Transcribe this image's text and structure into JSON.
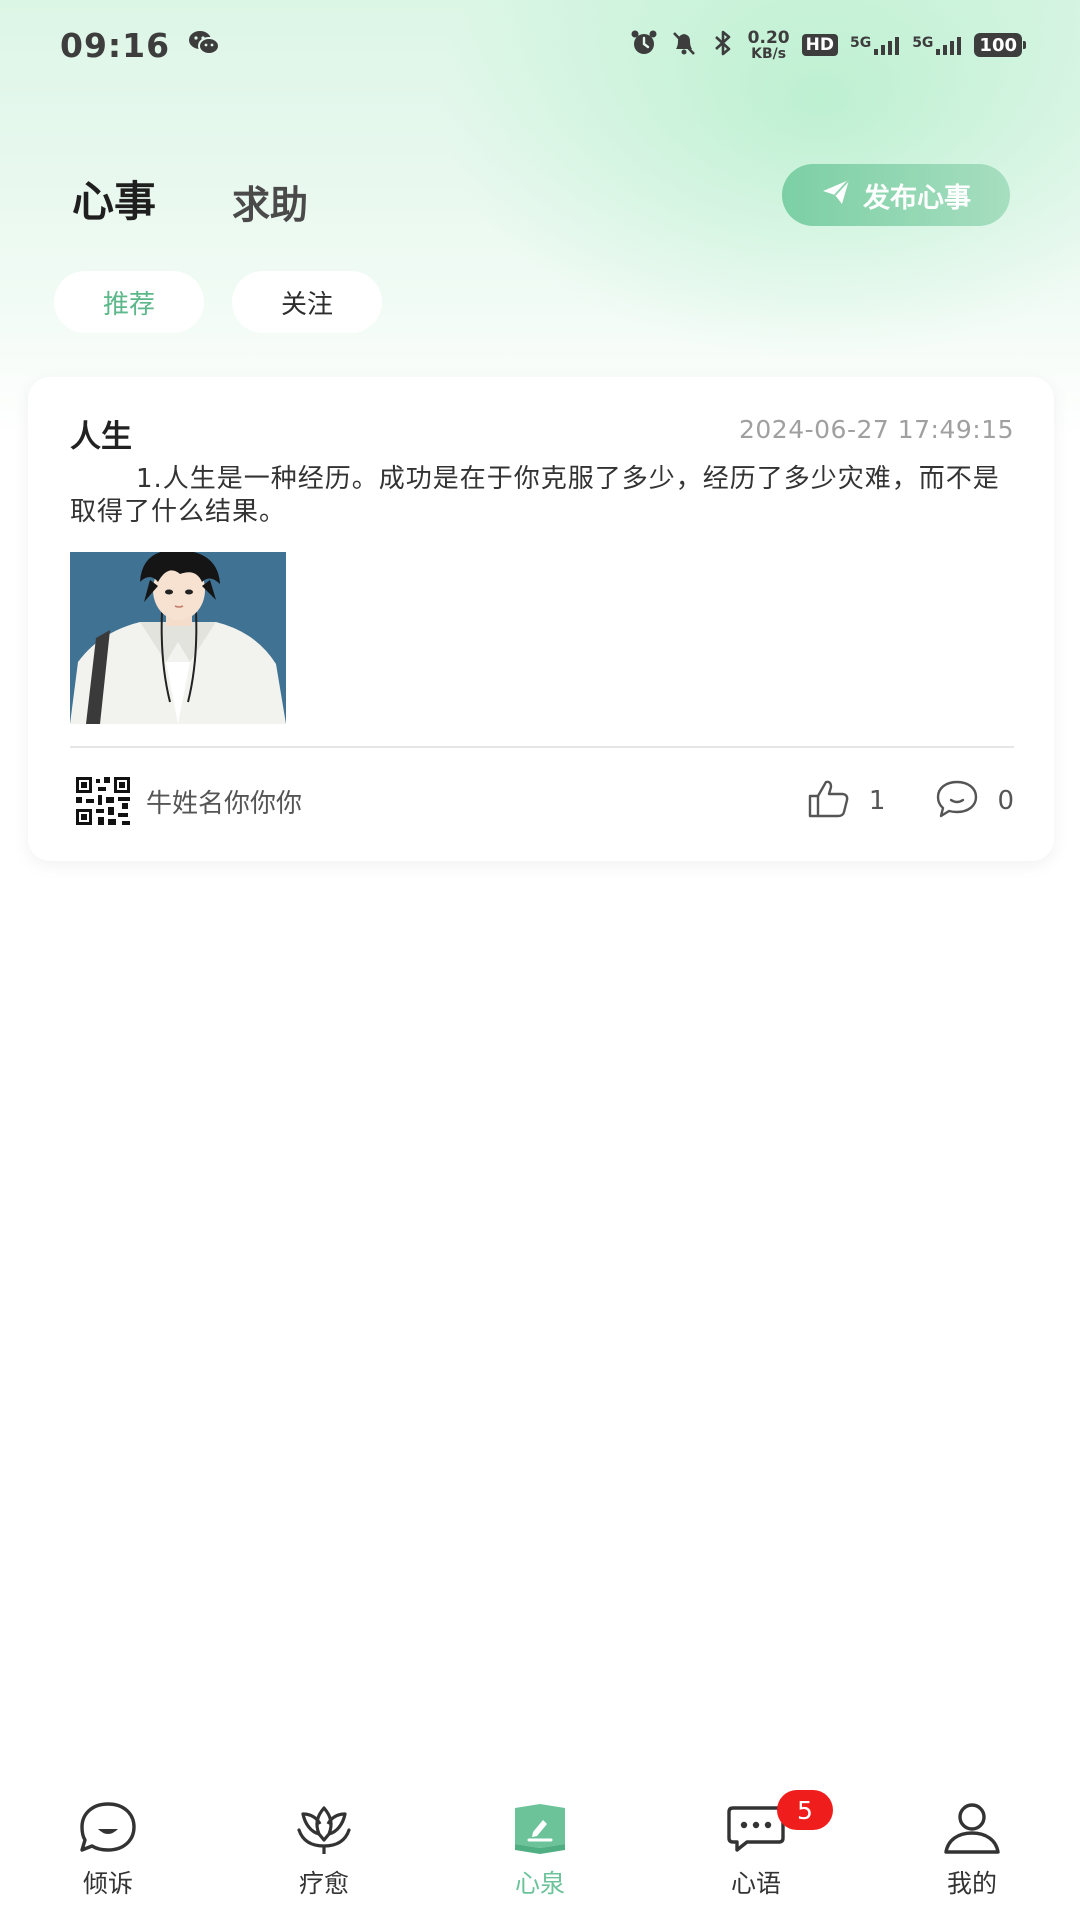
{
  "status_bar": {
    "time": "09:16",
    "net_speed_value": "0.20",
    "net_speed_unit": "KB/s",
    "hd_label": "HD",
    "signal1_label": "5G",
    "signal2_label": "5G",
    "battery": "100"
  },
  "header": {
    "tabs": [
      {
        "label": "心事",
        "active": true
      },
      {
        "label": "求助",
        "active": false
      }
    ],
    "publish_label": "发布心事"
  },
  "sub_tabs": [
    {
      "label": "推荐",
      "active": true
    },
    {
      "label": "关注",
      "active": false
    }
  ],
  "posts": [
    {
      "title": "人生",
      "time": "2024-06-27 17:49:15",
      "content": "1.人生是一种经历。成功是在于你克服了多少，经历了多少灾难，而不是取得了什么结果。",
      "author": "牛姓名你你你",
      "likes": "1",
      "comments": "0"
    }
  ],
  "bottom_nav": [
    {
      "label": "倾诉",
      "icon": "face-icon",
      "active": false
    },
    {
      "label": "疗愈",
      "icon": "lotus-icon",
      "active": false
    },
    {
      "label": "心泉",
      "icon": "book-pen-icon",
      "active": true
    },
    {
      "label": "心语",
      "icon": "chat-icon",
      "active": false,
      "badge": "5"
    },
    {
      "label": "我的",
      "icon": "person-icon",
      "active": false
    }
  ],
  "colors": {
    "accent": "#6cc39a",
    "badge": "#f01d1d"
  }
}
